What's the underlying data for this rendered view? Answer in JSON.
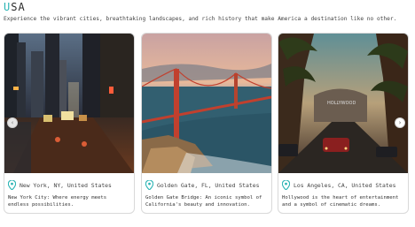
{
  "header": {
    "title_accent": "U",
    "title_rest": "SA",
    "subtitle": "Experience the vibrant cities, breathtaking landscapes, and rich history that make America a destination like no other."
  },
  "cards": [
    {
      "location": "New York, NY, United States",
      "description": "New York City: Where energy meets endless possibilities.",
      "photo_icon": "city-night-street-image"
    },
    {
      "location": "Golden Gate, FL, United States",
      "description": "Golden Gate Bridge: An iconic symbol of California's beauty and innovation.",
      "photo_icon": "golden-gate-bridge-image"
    },
    {
      "location": "Los Angeles, CA, United States",
      "description": "Hollywood is the heart of entertainment and a symbol of cinematic dreams.",
      "photo_icon": "palm-tree-street-image"
    }
  ],
  "carousel": {
    "prev_icon": "‹",
    "next_icon": "›"
  },
  "colors": {
    "accent": "#2bb4b4",
    "pin": "#2bb4b4"
  }
}
